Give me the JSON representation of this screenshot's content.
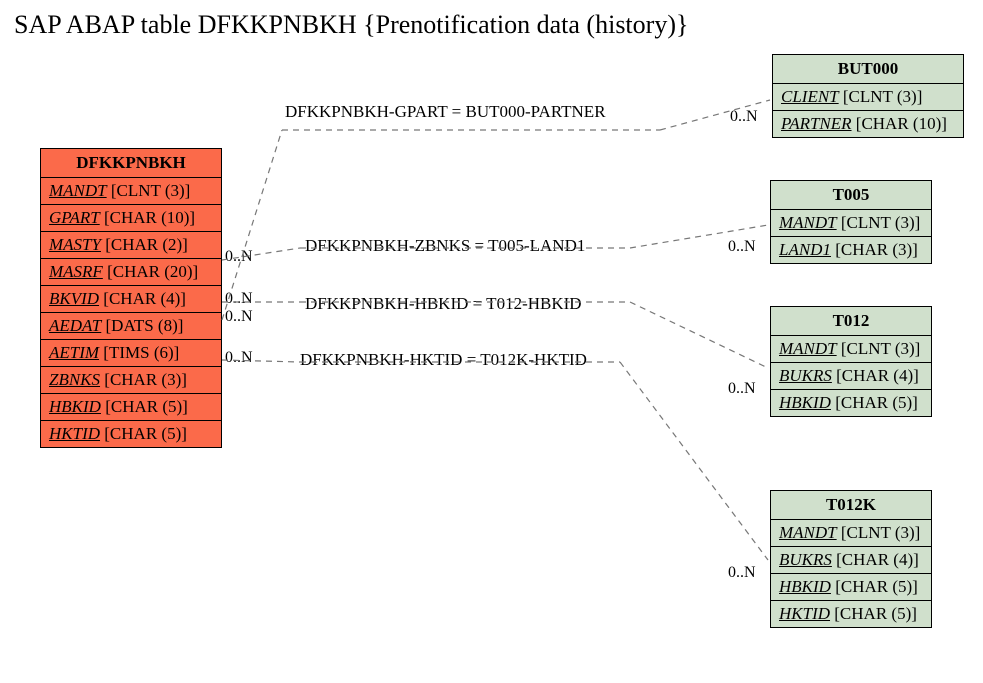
{
  "title": "SAP ABAP table DFKKPNBKH {Prenotification data (history)}",
  "main": {
    "name": "DFKKPNBKH",
    "fields": [
      {
        "name": "MANDT",
        "type": "[CLNT (3)]"
      },
      {
        "name": "GPART",
        "type": "[CHAR (10)]"
      },
      {
        "name": "MASTY",
        "type": "[CHAR (2)]"
      },
      {
        "name": "MASRF",
        "type": "[CHAR (20)]"
      },
      {
        "name": "BKVID",
        "type": "[CHAR (4)]"
      },
      {
        "name": "AEDAT",
        "type": "[DATS (8)]"
      },
      {
        "name": "AETIM",
        "type": "[TIMS (6)]"
      },
      {
        "name": "ZBNKS",
        "type": "[CHAR (3)]"
      },
      {
        "name": "HBKID",
        "type": "[CHAR (5)]"
      },
      {
        "name": "HKTID",
        "type": "[CHAR (5)]"
      }
    ]
  },
  "refs": [
    {
      "name": "BUT000",
      "fields": [
        {
          "name": "CLIENT",
          "type": "[CLNT (3)]"
        },
        {
          "name": "PARTNER",
          "type": "[CHAR (10)]"
        }
      ]
    },
    {
      "name": "T005",
      "fields": [
        {
          "name": "MANDT",
          "type": "[CLNT (3)]"
        },
        {
          "name": "LAND1",
          "type": "[CHAR (3)]"
        }
      ]
    },
    {
      "name": "T012",
      "fields": [
        {
          "name": "MANDT",
          "type": "[CLNT (3)]"
        },
        {
          "name": "BUKRS",
          "type": "[CHAR (4)]"
        },
        {
          "name": "HBKID",
          "type": "[CHAR (5)]"
        }
      ]
    },
    {
      "name": "T012K",
      "fields": [
        {
          "name": "MANDT",
          "type": "[CLNT (3)]"
        },
        {
          "name": "BUKRS",
          "type": "[CHAR (4)]"
        },
        {
          "name": "HBKID",
          "type": "[CHAR (5)]"
        },
        {
          "name": "HKTID",
          "type": "[CHAR (5)]"
        }
      ]
    }
  ],
  "relations": [
    {
      "label": "DFKKPNBKH-GPART = BUT000-PARTNER",
      "left_card": "0..N",
      "right_card": "0..N"
    },
    {
      "label": "DFKKPNBKH-ZBNKS = T005-LAND1",
      "left_card": "0..N",
      "right_card": "0..N"
    },
    {
      "label": "DFKKPNBKH-HBKID = T012-HBKID",
      "left_card": "0..N",
      "right_card": "0..N"
    },
    {
      "label": "DFKKPNBKH-HKTID = T012K-HKTID",
      "left_card": "0..N",
      "right_card": "0..N"
    }
  ]
}
